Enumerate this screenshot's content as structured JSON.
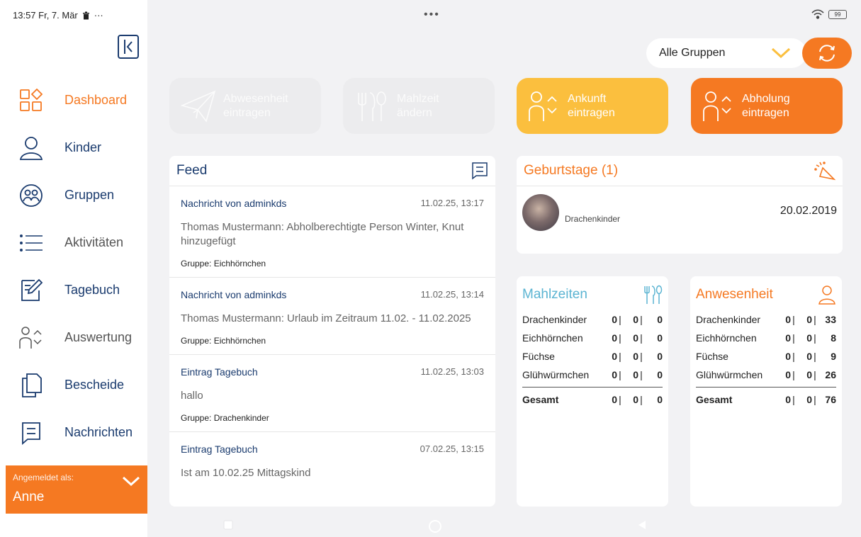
{
  "status": {
    "time_date": "13:57 Fr, 7. Mär",
    "more": "···",
    "top_dots": "•••",
    "battery": "99"
  },
  "sidebar": {
    "items": [
      {
        "label": "Dashboard",
        "icon": "dashboard-icon"
      },
      {
        "label": "Kinder",
        "icon": "person-icon"
      },
      {
        "label": "Gruppen",
        "icon": "group-icon"
      },
      {
        "label": "Aktivitäten",
        "icon": "list-icon"
      },
      {
        "label": "Tagebuch",
        "icon": "diary-edit-icon"
      },
      {
        "label": "Auswertung",
        "icon": "evaluation-icon"
      },
      {
        "label": "Bescheide",
        "icon": "documents-icon"
      },
      {
        "label": "Nachrichten",
        "icon": "message-icon"
      }
    ],
    "login_label": "Angemeldet als:",
    "login_user": "Anne"
  },
  "header": {
    "group_select": "Alle Gruppen"
  },
  "actions": {
    "absence": "Abwesenheit eintragen",
    "absence_l1": "Abwesenheit",
    "absence_l2": "eintragen",
    "meal_l1": "Mahlzeit",
    "meal_l2": "ändern",
    "arrival_l1": "Ankunft",
    "arrival_l2": "eintragen",
    "pickup_l1": "Abholung",
    "pickup_l2": "eintragen"
  },
  "feed": {
    "title": "Feed",
    "items": [
      {
        "title": "Nachricht von adminkds",
        "date": "11.02.25, 13:17",
        "body": "Thomas Mustermann: Abholberechtigte Person Winter, Knut hinzugefügt",
        "group": "Gruppe: Eichhörnchen"
      },
      {
        "title": "Nachricht von adminkds",
        "date": "11.02.25, 13:14",
        "body": "Thomas Mustermann: Urlaub im Zeitraum 11.02. - 11.02.2025",
        "group": "Gruppe: Eichhörnchen"
      },
      {
        "title": "Eintrag Tagebuch",
        "date": "11.02.25, 13:03",
        "body": "hallo",
        "group": "Gruppe: Drachenkinder"
      },
      {
        "title": "Eintrag Tagebuch",
        "date": "07.02.25, 13:15",
        "body": "Ist am 10.02.25 Mittagskind",
        "group": ""
      }
    ]
  },
  "birthdays": {
    "title": "Geburtstage (1)",
    "group": "Drachenkinder",
    "date": "20.02.2019"
  },
  "meals": {
    "title": "Mahlzeiten",
    "rows": [
      {
        "name": "Drachenkinder",
        "a": "0",
        "b": "0",
        "c": "0"
      },
      {
        "name": "Eichhörnchen",
        "a": "0",
        "b": "0",
        "c": "0"
      },
      {
        "name": "Füchse",
        "a": "0",
        "b": "0",
        "c": "0"
      },
      {
        "name": "Glühwürmchen",
        "a": "0",
        "b": "0",
        "c": "0"
      }
    ],
    "total": {
      "name": "Gesamt",
      "a": "0",
      "b": "0",
      "c": "0"
    }
  },
  "attendance": {
    "title": "Anwesenheit",
    "rows": [
      {
        "name": "Drachenkinder",
        "a": "0",
        "b": "0",
        "c": "33"
      },
      {
        "name": "Eichhörnchen",
        "a": "0",
        "b": "0",
        "c": "8"
      },
      {
        "name": "Füchse",
        "a": "0",
        "b": "0",
        "c": "9"
      },
      {
        "name": "Glühwürmchen",
        "a": "0",
        "b": "0",
        "c": "26"
      }
    ],
    "total": {
      "name": "Gesamt",
      "a": "0",
      "b": "0",
      "c": "76"
    }
  },
  "colors": {
    "accent": "#f57922",
    "yellow": "#fbbf3e",
    "navy": "#1a3b6e",
    "teal": "#5bb4d2"
  }
}
